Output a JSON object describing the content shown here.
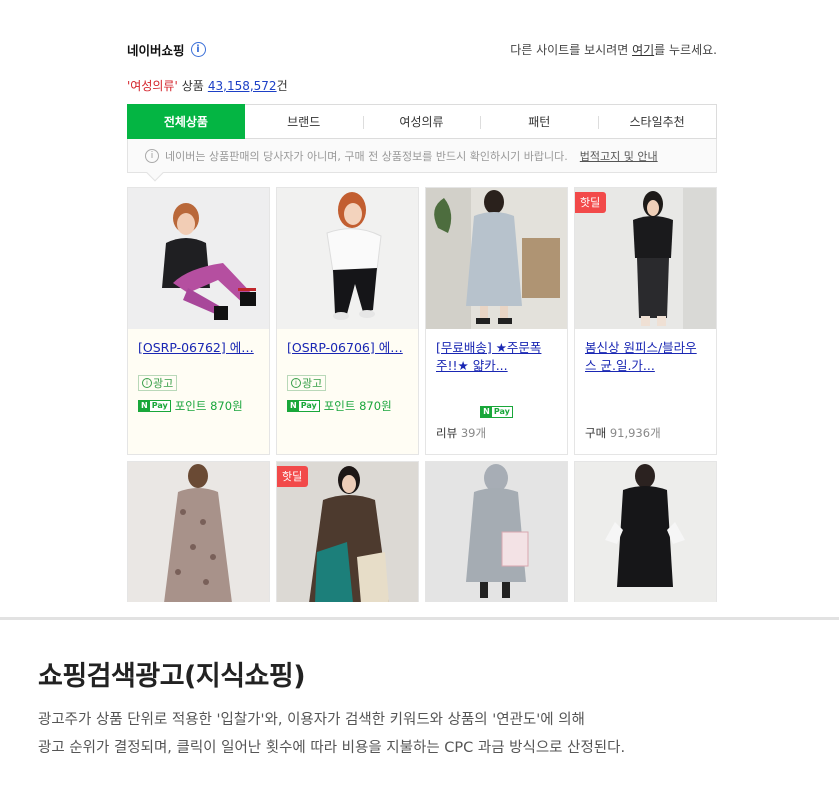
{
  "header": {
    "brand": "네이버쇼핑",
    "info_icon": "i",
    "other_site": {
      "prefix": "다른 사이트를 보시려면 ",
      "link": "여기",
      "suffix": "를 누르세요."
    }
  },
  "count": {
    "category": "'여성의류'",
    "label": "상품",
    "value": "43,158,572",
    "unit": "건"
  },
  "tabs": [
    {
      "label": "전체상품",
      "active": true
    },
    {
      "label": "브랜드"
    },
    {
      "label": "여성의류"
    },
    {
      "label": "패턴"
    },
    {
      "label": "스타일추천"
    }
  ],
  "notice": {
    "text": "네이버는 상품판매의 당사자가 아니며, 구매 전 상품정보를 반드시 확인하시기 바랍니다.",
    "link": "법적고지 및 안내"
  },
  "products": [
    {
      "title": "[OSRP-06762] 에…",
      "ad_label": "광고",
      "pay_label": "포인트 870원"
    },
    {
      "title": "[OSRP-06706] 에…",
      "ad_label": "광고",
      "pay_label": "포인트 870원"
    },
    {
      "title": "[무료배송] ★주문폭주!!★ 얇카...",
      "meta_label": "리뷰",
      "meta_value": "39개"
    },
    {
      "hot": "핫딜",
      "title": "봄신상 원피스/블라우스 균.일.가...",
      "meta_label": "구매",
      "meta_value": "91,936개"
    }
  ],
  "products_row2": [
    {
      "hot": ""
    },
    {
      "hot": "핫딜"
    },
    {
      "hot": ""
    },
    {
      "hot": ""
    }
  ],
  "npay": {
    "n": "N",
    "pay": "Pay"
  },
  "bottom": {
    "title": "쇼핑검색광고(지식쇼핑)",
    "line1": "광고주가 상품 단위로 적용한 '입찰가'와, 이용자가 검색한 키워드와 상품의 '연관도'에 의해",
    "line2": "광고 순위가 결정되며, 클릭이 일어난 횟수에 따라 비용을 지불하는 CPC 과금 방식으로 산정된다."
  }
}
